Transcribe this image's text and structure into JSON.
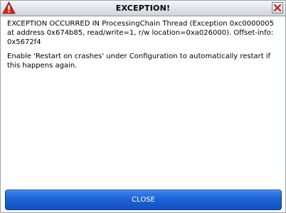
{
  "window": {
    "title": "EXCEPTION!",
    "title_icon": "warning-triangle-icon",
    "close_icon": "close-x-icon"
  },
  "message": {
    "line1": "EXCEPTION OCCURRED IN ProcessingChain Thread (Exception 0xc0000005 at address 0x674b85, read/write=1, r/w location=0xa026000). Offset-info: 0x5672f4",
    "line2": "Enable 'Restart on crashes' under Configuration to automatically restart if this happens again."
  },
  "buttons": {
    "close_label": "CLOSE"
  },
  "colors": {
    "accent_button": "#1d63d8",
    "warning_icon": "#d62a1e",
    "close_x": "#c0201a"
  }
}
